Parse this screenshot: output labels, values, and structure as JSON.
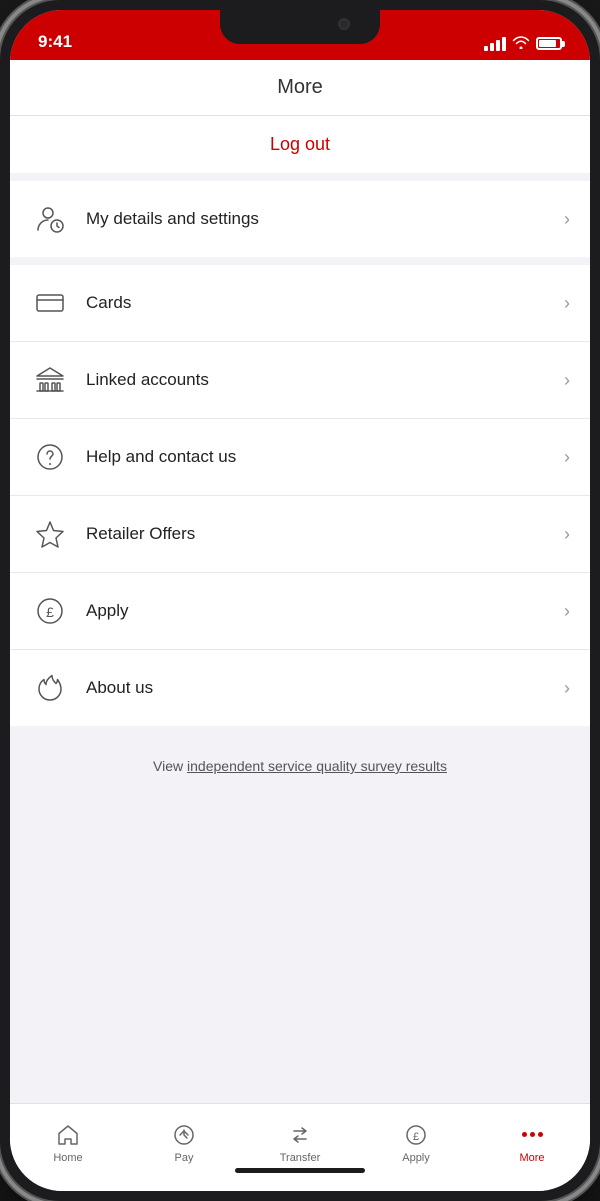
{
  "status_bar": {
    "time": "9:41"
  },
  "header": {
    "title": "More"
  },
  "logout": {
    "label": "Log out"
  },
  "menu": {
    "items": [
      {
        "id": "my-details",
        "label": "My details and settings",
        "icon": "person-settings"
      },
      {
        "id": "cards",
        "label": "Cards",
        "icon": "card"
      },
      {
        "id": "linked-accounts",
        "label": "Linked accounts",
        "icon": "bank"
      },
      {
        "id": "help-contact",
        "label": "Help and contact us",
        "icon": "help"
      },
      {
        "id": "retailer-offers",
        "label": "Retailer Offers",
        "icon": "star"
      },
      {
        "id": "apply",
        "label": "Apply",
        "icon": "pound"
      },
      {
        "id": "about-us",
        "label": "About us",
        "icon": "flame"
      }
    ]
  },
  "survey": {
    "prefix": "View ",
    "link_text": "independent service quality survey results"
  },
  "bottom_nav": {
    "items": [
      {
        "id": "home",
        "label": "Home",
        "active": false
      },
      {
        "id": "pay",
        "label": "Pay",
        "active": false
      },
      {
        "id": "transfer",
        "label": "Transfer",
        "active": false
      },
      {
        "id": "apply",
        "label": "Apply",
        "active": false
      },
      {
        "id": "more",
        "label": "More",
        "active": true
      }
    ]
  }
}
